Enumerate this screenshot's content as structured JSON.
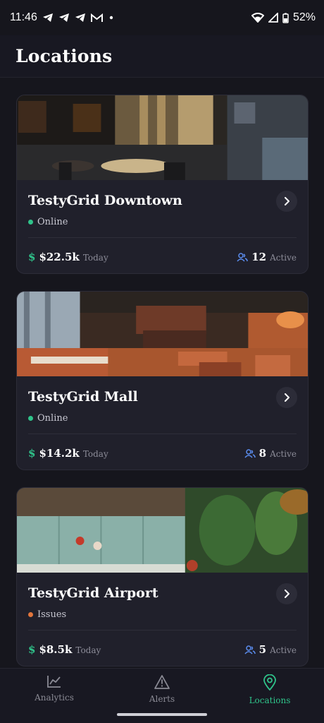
{
  "status_bar": {
    "time": "11:46",
    "notification_icons": [
      "telegram-icon",
      "telegram-icon",
      "telegram-icon",
      "gmail-icon",
      "dot-icon"
    ],
    "battery": "52%"
  },
  "header": {
    "title": "Locations"
  },
  "locations": [
    {
      "name": "TestyGrid Downtown",
      "status": "Online",
      "status_color": "#2fc38a",
      "revenue": "$22.5k",
      "revenue_period": "Today",
      "active_count": "12",
      "active_label": "Active"
    },
    {
      "name": "TestyGrid Mall",
      "status": "Online",
      "status_color": "#2fc38a",
      "revenue": "$14.2k",
      "revenue_period": "Today",
      "active_count": "8",
      "active_label": "Active"
    },
    {
      "name": "TestyGrid Airport",
      "status": "Issues",
      "status_color": "#e2763c",
      "revenue": "$8.5k",
      "revenue_period": "Today",
      "active_count": "5",
      "active_label": "Active"
    }
  ],
  "currency_symbol": "$",
  "tabs": [
    {
      "label": "Analytics",
      "icon": "chart-line-icon",
      "active": false
    },
    {
      "label": "Alerts",
      "icon": "alert-triangle-icon",
      "active": false
    },
    {
      "label": "Locations",
      "icon": "map-pin-icon",
      "active": true
    }
  ],
  "colors": {
    "accent": "#2fc38a",
    "background": "#16161d",
    "card": "#20202b",
    "users_icon": "#5b8def"
  }
}
